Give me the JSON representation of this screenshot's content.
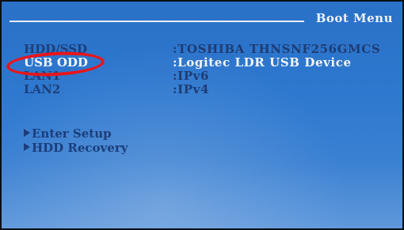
{
  "header": {
    "title": "Boot Menu"
  },
  "devices": [
    {
      "name": "HDD/SSD",
      "value": ":TOSHIBA THNSNF256GMCS"
    },
    {
      "name": "USB ODD",
      "value": ":Logitec  LDR USB Device"
    },
    {
      "name": "LAN1",
      "value": ":IPv6"
    },
    {
      "name": "LAN2",
      "value": ":IPv4"
    }
  ],
  "actions": [
    {
      "label": "Enter Setup"
    },
    {
      "label": "HDD Recovery"
    }
  ],
  "colors": {
    "background": "#2e78cf",
    "text": "#1d3f7a",
    "title": "#eef3fa",
    "annotation_ring": "#e8161b"
  }
}
